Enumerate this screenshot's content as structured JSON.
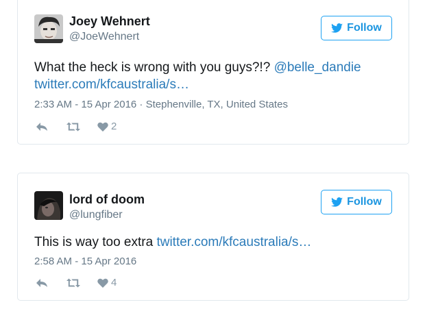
{
  "tweets": [
    {
      "name": "Joey Wehnert",
      "handle": "@JoeWehnert",
      "follow_label": "Follow",
      "text": "What the heck is wrong with you guys?!? ",
      "mention": "@belle_dandie",
      "link": "twitter.com/kfcaustralia/s…",
      "timestamp": "2:33 AM - 15 Apr 2016 · Stephenville, TX, United States",
      "likes": "2",
      "icons": [
        "avatar",
        "twitter-bird-icon",
        "reply-icon",
        "retweet-icon",
        "heart-icon"
      ]
    },
    {
      "name": "lord of doom",
      "handle": "@lungfiber",
      "follow_label": "Follow",
      "text": "This is way too extra ",
      "link": "twitter.com/kfcaustralia/s…",
      "timestamp": "2:58 AM - 15 Apr 2016",
      "likes": "4",
      "icons": [
        "avatar",
        "twitter-bird-icon",
        "reply-icon",
        "retweet-icon",
        "heart-icon"
      ]
    }
  ],
  "colors": {
    "accent": "#1da1f2",
    "link": "#2b7bb9",
    "muted": "#657786",
    "border": "#e1e8ed"
  }
}
